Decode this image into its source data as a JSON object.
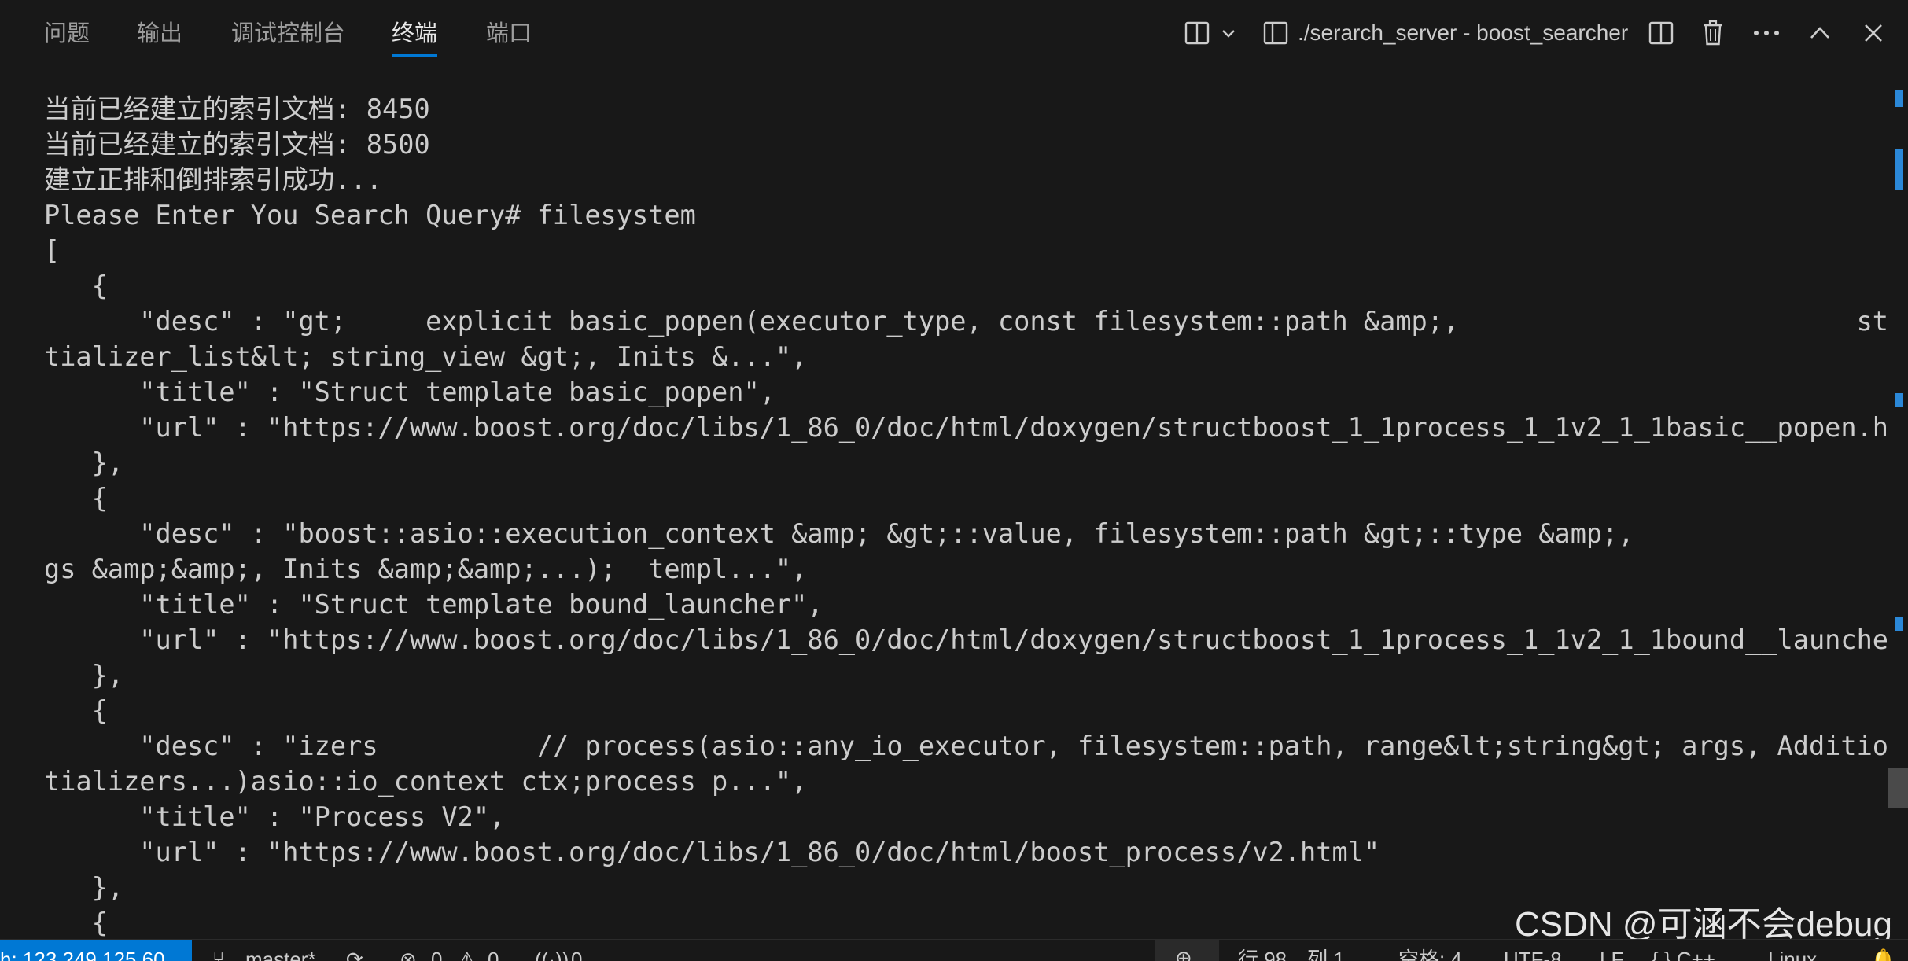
{
  "panel": {
    "tabs": [
      {
        "label": "问题"
      },
      {
        "label": "输出"
      },
      {
        "label": "调试控制台"
      },
      {
        "label": "终端"
      },
      {
        "label": "端口"
      }
    ],
    "active_tab": "终端",
    "terminal_title": "./serarch_server - boost_searcher",
    "icons": {
      "layout": "split-layout-icon",
      "chevron": "chevron-down-icon",
      "terminal": "terminal-icon",
      "split": "split-terminal-icon",
      "trash": "trash-icon",
      "more": "more-icon",
      "maximize": "chevron-up-icon",
      "close": "close-icon"
    }
  },
  "terminal": {
    "lines": [
      "当前已经建立的索引文档: 8450",
      "当前已经建立的索引文档: 8500",
      "建立正排和倒排索引成功...",
      "Please Enter You Search Query# filesystem",
      "[",
      "   {",
      "      \"desc\" : \"gt;     explicit basic_popen(executor_type, const filesystem::path &amp;,                         std::ini",
      "tializer_list&lt; string_view &gt;, Inits &...\",",
      "      \"title\" : \"Struct template basic_popen\",",
      "      \"url\" : \"https://www.boost.org/doc/libs/1_86_0/doc/html/doxygen/structboost_1_1process_1_1v2_1_1basic__popen.html\"",
      "   },",
      "   {",
      "      \"desc\" : \"boost::asio::execution_context &amp; &gt;::value, filesystem::path &gt;::type &amp;,                     Ar",
      "gs &amp;&amp;, Inits &amp;&amp;...);  templ...\",",
      "      \"title\" : \"Struct template bound_launcher\",",
      "      \"url\" : \"https://www.boost.org/doc/libs/1_86_0/doc/html/doxygen/structboost_1_1process_1_1v2_1_1bound__launcher.html\"",
      "   },",
      "   {",
      "      \"desc\" : \"izers          // process(asio::any_io_executor, filesystem::path, range&lt;string&gt; args, AdditionalIni",
      "tializers...)asio::io_context ctx;process p...\",",
      "      \"title\" : \"Process V2\",",
      "      \"url\" : \"https://www.boost.org/doc/libs/1_86_0/doc/html/boost_process/v2.html\"",
      "   },",
      "   {"
    ]
  },
  "status_bar": {
    "remote": "h: 123.249.125.60",
    "branch": "master*",
    "errors": "0",
    "warnings": "0",
    "ports": "0",
    "line_col": "行 98，列 1",
    "spaces": "空格: 4",
    "encoding": "UTF-8",
    "eol": "LF",
    "language": "{ } C++",
    "platform": "Linux"
  },
  "watermark": "CSDN @可涵不会debug",
  "colors": {
    "background": "#181818",
    "text": "#cccccc",
    "accent": "#0078d4"
  }
}
